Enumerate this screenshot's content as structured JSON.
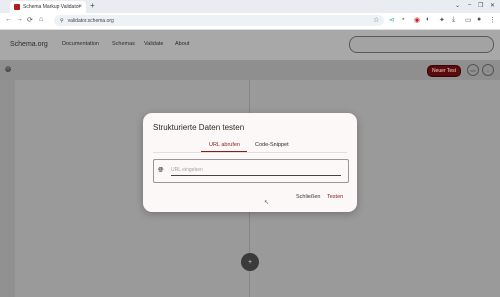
{
  "browser": {
    "tab_title": "Schema Markup Validator",
    "url": "validator.schema.org",
    "new_tab": "+",
    "tab_close": "×",
    "window_controls": [
      "⌄",
      "–",
      "❐",
      "✕"
    ],
    "nav": [
      "←",
      "→",
      "⟳",
      "⌂"
    ]
  },
  "site": {
    "logo": "Schema.org",
    "nav": [
      "Documentation",
      "Schemas",
      "Validate",
      "About"
    ],
    "new_test_label": "Neuer Test",
    "circle_buttons": [
      "</>",
      "◌"
    ],
    "fab_icon": "+"
  },
  "modal": {
    "title": "Strukturierte Daten testen",
    "tabs": [
      "URL abrufen",
      "Code-Snippet"
    ],
    "active_tab": 0,
    "url_placeholder": "URL eingeben",
    "close_label": "Schließen",
    "test_label": "Testen"
  },
  "colors": {
    "accent": "#8b1a1a",
    "new_test_bg": "#5c0b0b",
    "overlay": "#9a9a9a"
  }
}
